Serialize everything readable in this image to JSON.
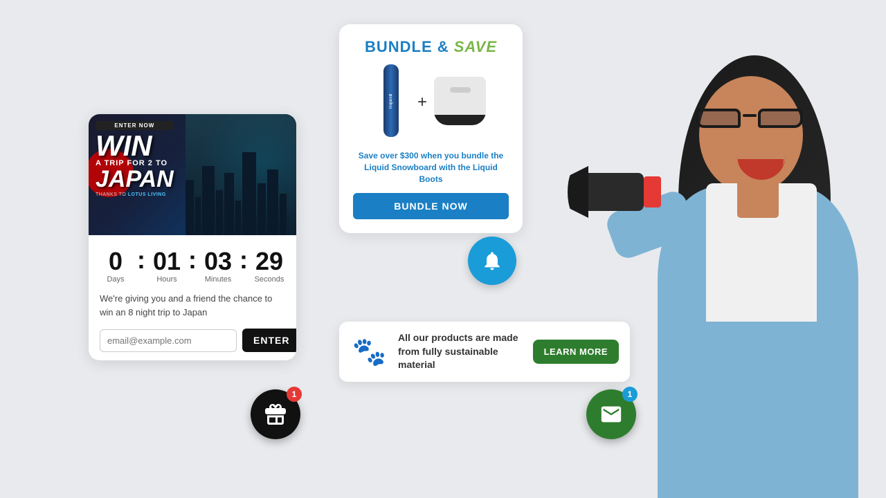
{
  "japan_card": {
    "enter_now": "ENTER NOW",
    "win": "WIN",
    "trip_for_2": "A TRIP FOR 2 TO",
    "japan": "JAPAN",
    "thanks_text": "THANKS TO",
    "lotus_living": "LOTUS LIVING",
    "days": "0",
    "hours": "01",
    "minutes": "03",
    "seconds": "29",
    "days_label": "Days",
    "hours_label": "Hours",
    "minutes_label": "Minutes",
    "seconds_label": "Seconds",
    "promo_text": "We're giving you and a friend the chance to win an 8 night trip to Japan",
    "email_placeholder": "email@example.com",
    "enter_button": "ENTER"
  },
  "bundle_card": {
    "bundle_text": "BUNDLE &",
    "save_text": "SAVE",
    "product1_name": "Liquid Snowboard",
    "product2_name": "Liquid Boots",
    "description": "Save over $300 when you bundle the Liquid Snowboard with the Liquid Boots",
    "button_label": "BUNDLE NOW"
  },
  "bell_button": {
    "label": "notifications"
  },
  "sustainable_banner": {
    "icon": "🐾",
    "text": "All our products are made from fully sustainable material",
    "button_label": "LEARN MORE"
  },
  "gift_button": {
    "badge": "1",
    "label": "gifts"
  },
  "email_button": {
    "badge": "1",
    "label": "messages"
  },
  "colors": {
    "blue": "#1a9cd8",
    "green": "#2e7d2e",
    "dark": "#111111",
    "red": "#e53935"
  }
}
